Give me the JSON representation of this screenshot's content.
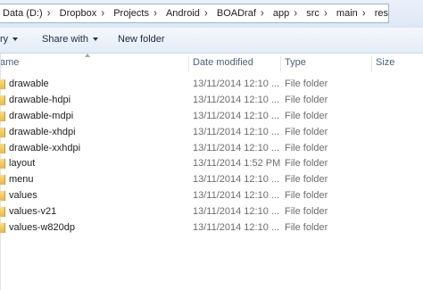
{
  "address_bar": {
    "crumbs": [
      "Data (D:)",
      "Dropbox",
      "Projects",
      "Android",
      "BOADraf",
      "app",
      "src",
      "main",
      "res"
    ],
    "separator": "›"
  },
  "toolbar": {
    "organize_label": "ry",
    "share_label": "Share with",
    "new_folder_label": "New folder"
  },
  "columns": {
    "name": "ame",
    "date": "Date modified",
    "type": "Type",
    "size": "Size"
  },
  "files": [
    {
      "name": "drawable",
      "date": "13/11/2014 12:10 ...",
      "type": "File folder",
      "size": ""
    },
    {
      "name": "drawable-hdpi",
      "date": "13/11/2014 12:10 ...",
      "type": "File folder",
      "size": ""
    },
    {
      "name": "drawable-mdpi",
      "date": "13/11/2014 12:10 ...",
      "type": "File folder",
      "size": ""
    },
    {
      "name": "drawable-xhdpi",
      "date": "13/11/2014 12:10 ...",
      "type": "File folder",
      "size": ""
    },
    {
      "name": "drawable-xxhdpi",
      "date": "13/11/2014 12:10 ...",
      "type": "File folder",
      "size": ""
    },
    {
      "name": "layout",
      "date": "13/11/2014 1:52 PM",
      "type": "File folder",
      "size": ""
    },
    {
      "name": "menu",
      "date": "13/11/2014 12:10 ...",
      "type": "File folder",
      "size": ""
    },
    {
      "name": "values",
      "date": "13/11/2014 12:10 ...",
      "type": "File folder",
      "size": ""
    },
    {
      "name": "values-v21",
      "date": "13/11/2014 12:10 ...",
      "type": "File folder",
      "size": ""
    },
    {
      "name": "values-w820dp",
      "date": "13/11/2014 12:10 ...",
      "type": "File folder",
      "size": ""
    }
  ],
  "icons": {
    "folder": "folder-icon",
    "breadcrumb_separator": "chevron-right-icon",
    "dropdown": "chevron-down-icon",
    "sort": "sort-up-icon"
  }
}
